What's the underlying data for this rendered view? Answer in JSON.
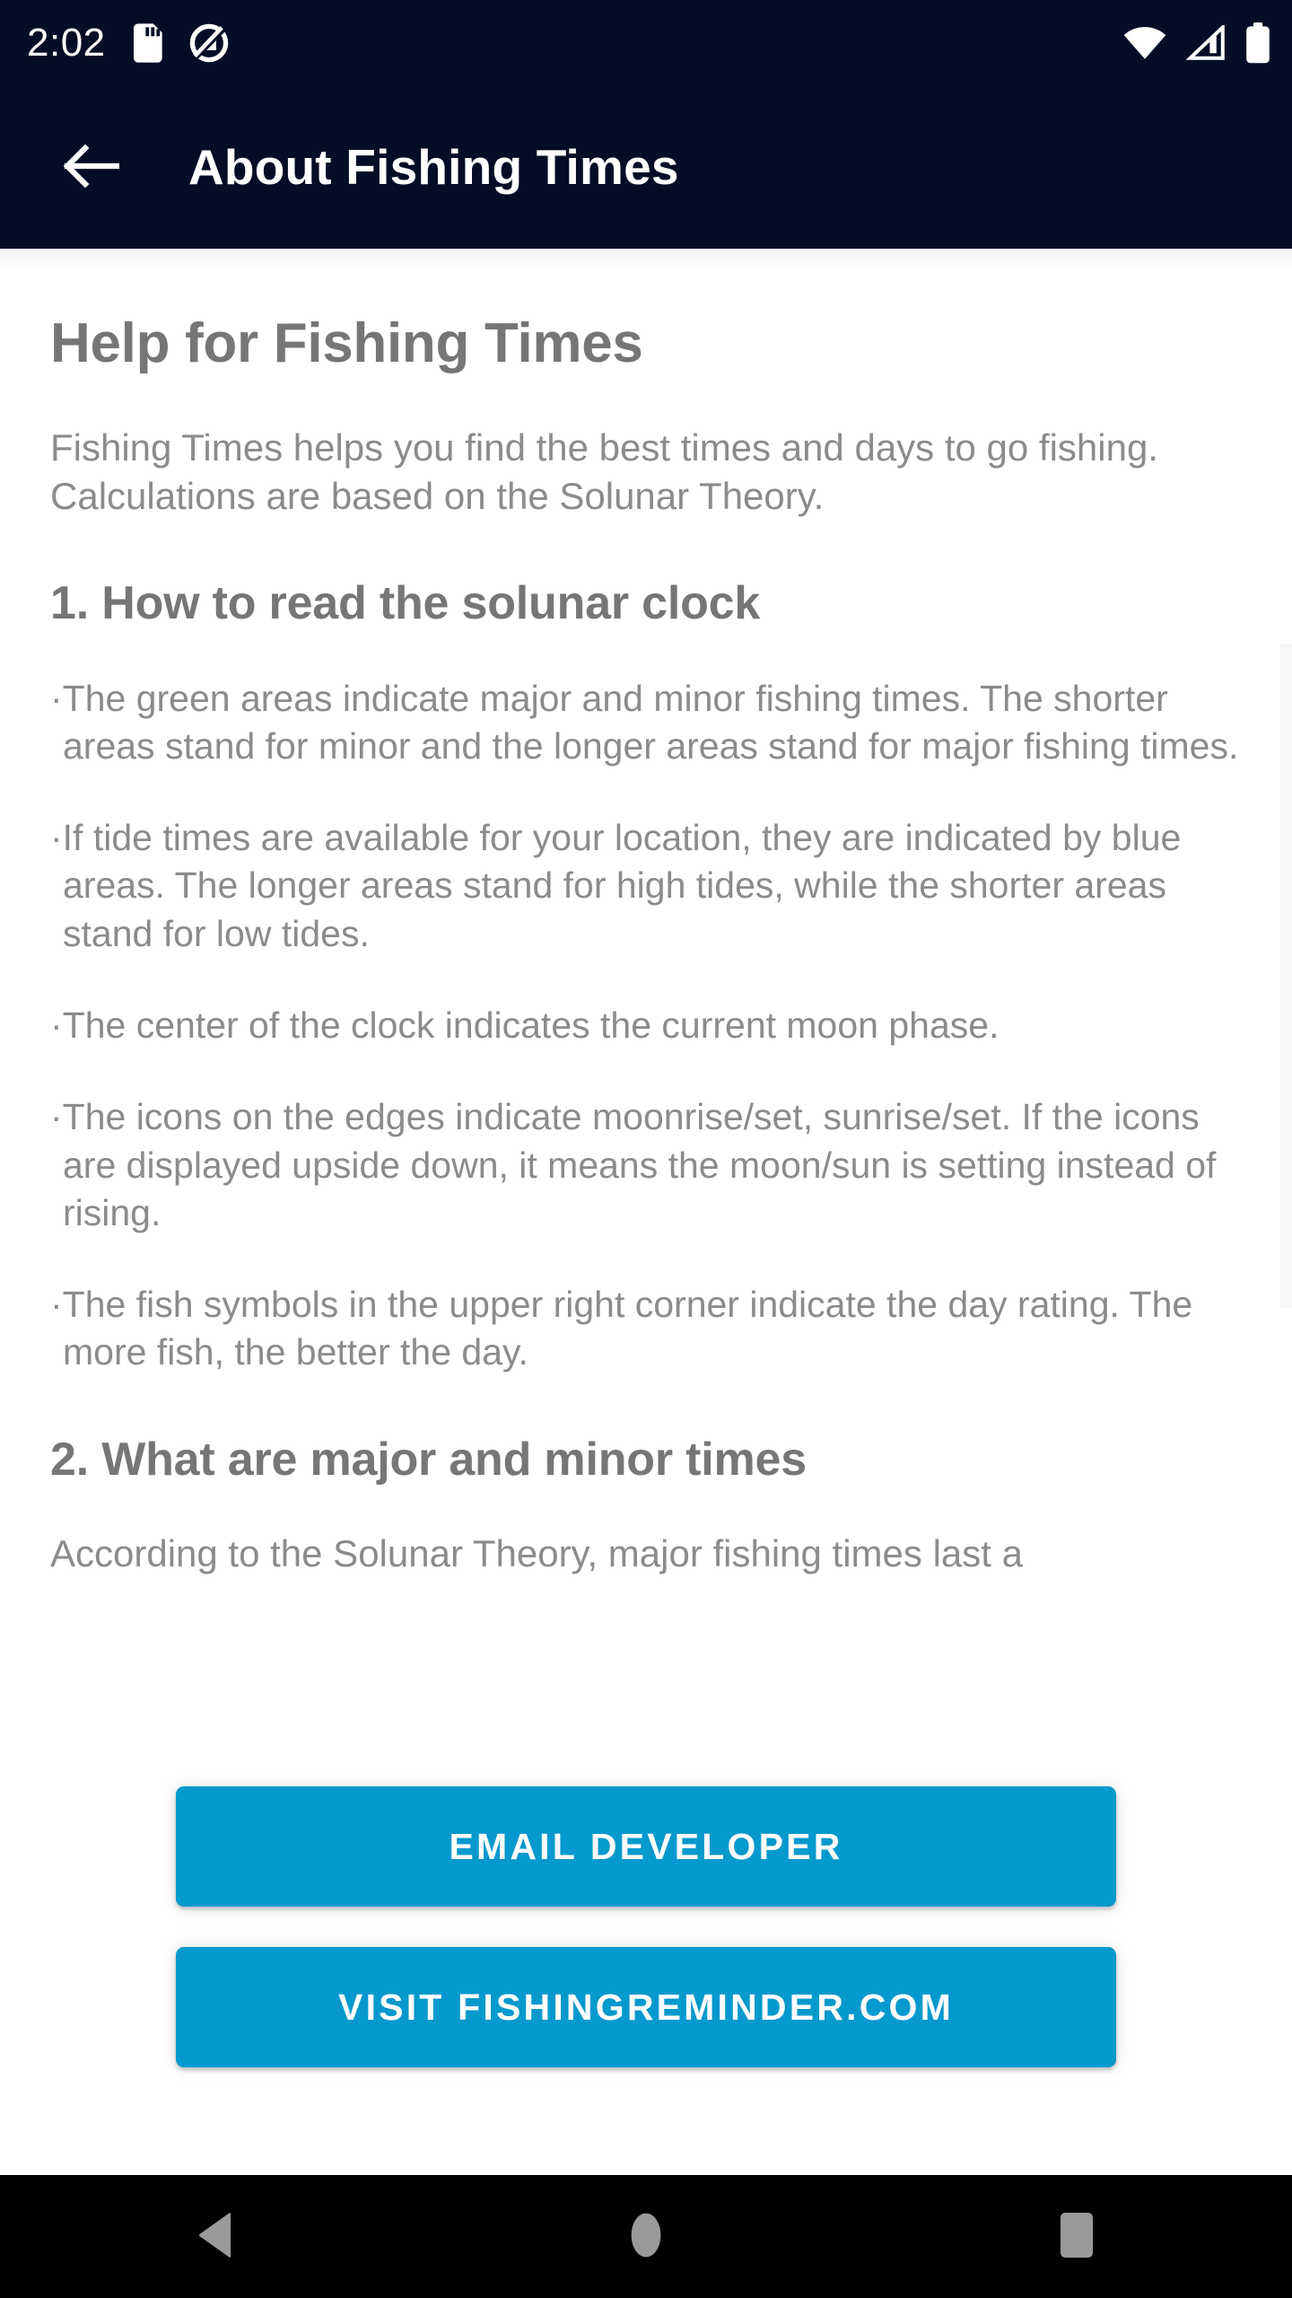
{
  "status_bar": {
    "time": "2:02",
    "icons": [
      "sd-card-icon",
      "do-not-disturb-icon",
      "wifi-icon",
      "cellular-signal-icon",
      "battery-icon"
    ]
  },
  "app_bar": {
    "back_label": "back-arrow-icon",
    "title": "About Fishing Times"
  },
  "content": {
    "page_title": "Help for Fishing Times",
    "intro": "Fishing Times helps you find the best times and days to go fishing. Calculations are based on the Solunar Theory.",
    "section_1_heading": "1. How to read the solunar clock",
    "bullets": [
      "The green areas indicate major and minor fishing times. The shorter areas stand for minor and the longer areas stand for major fishing times.",
      "If tide times are available for your location, they are indicated by blue areas. The longer areas stand for high tides, while the shorter areas stand for low tides.",
      "The center of the clock indicates the current moon phase.",
      "The icons on the edges indicate moonrise/set, sunrise/set. If the icons are displayed upside down, it means the moon/sun is setting instead of rising.",
      "The fish symbols in the upper right corner indicate the day rating. The more fish, the better the day."
    ],
    "section_2_heading": "2. What are major and minor times",
    "section_2_paragraph": "According to the Solunar Theory, major fishing times last a"
  },
  "buttons": {
    "email_developer": "EMAIL DEVELOPER",
    "visit_website": "VISIT FISHINGREMINDER.COM",
    "accent_color": "#0699cd"
  },
  "nav_bar": {
    "back": "nav-back-icon",
    "home": "nav-home-icon",
    "recents": "nav-recents-icon"
  },
  "colors": {
    "app_bar_background": "#040d26",
    "content_background": "#ffffff",
    "text_gray": "#8b8b8b",
    "heading_gray": "#767676",
    "accent": "#0699cd",
    "nav_background": "#000000"
  }
}
